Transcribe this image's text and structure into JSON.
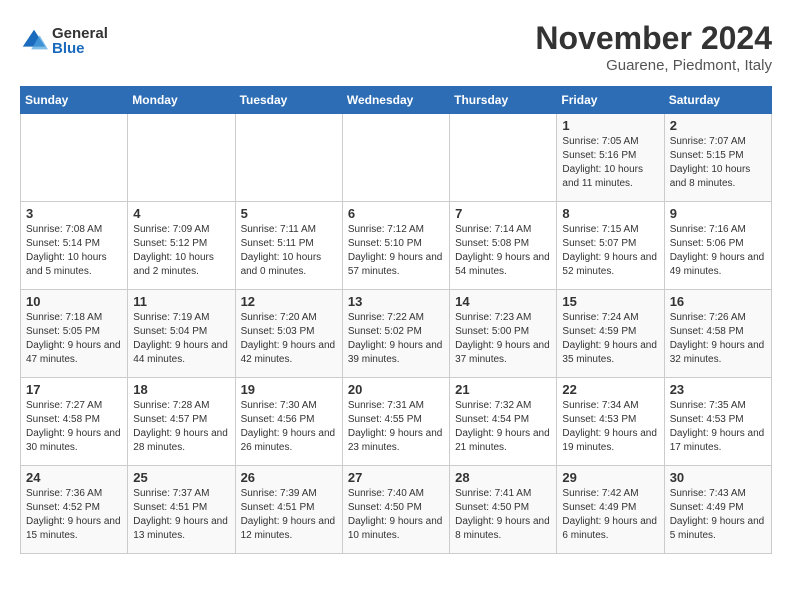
{
  "logo": {
    "general": "General",
    "blue": "Blue"
  },
  "title": "November 2024",
  "subtitle": "Guarene, Piedmont, Italy",
  "weekdays": [
    "Sunday",
    "Monday",
    "Tuesday",
    "Wednesday",
    "Thursday",
    "Friday",
    "Saturday"
  ],
  "weeks": [
    [
      {
        "day": "",
        "info": ""
      },
      {
        "day": "",
        "info": ""
      },
      {
        "day": "",
        "info": ""
      },
      {
        "day": "",
        "info": ""
      },
      {
        "day": "",
        "info": ""
      },
      {
        "day": "1",
        "info": "Sunrise: 7:05 AM\nSunset: 5:16 PM\nDaylight: 10 hours and 11 minutes."
      },
      {
        "day": "2",
        "info": "Sunrise: 7:07 AM\nSunset: 5:15 PM\nDaylight: 10 hours and 8 minutes."
      }
    ],
    [
      {
        "day": "3",
        "info": "Sunrise: 7:08 AM\nSunset: 5:14 PM\nDaylight: 10 hours and 5 minutes."
      },
      {
        "day": "4",
        "info": "Sunrise: 7:09 AM\nSunset: 5:12 PM\nDaylight: 10 hours and 2 minutes."
      },
      {
        "day": "5",
        "info": "Sunrise: 7:11 AM\nSunset: 5:11 PM\nDaylight: 10 hours and 0 minutes."
      },
      {
        "day": "6",
        "info": "Sunrise: 7:12 AM\nSunset: 5:10 PM\nDaylight: 9 hours and 57 minutes."
      },
      {
        "day": "7",
        "info": "Sunrise: 7:14 AM\nSunset: 5:08 PM\nDaylight: 9 hours and 54 minutes."
      },
      {
        "day": "8",
        "info": "Sunrise: 7:15 AM\nSunset: 5:07 PM\nDaylight: 9 hours and 52 minutes."
      },
      {
        "day": "9",
        "info": "Sunrise: 7:16 AM\nSunset: 5:06 PM\nDaylight: 9 hours and 49 minutes."
      }
    ],
    [
      {
        "day": "10",
        "info": "Sunrise: 7:18 AM\nSunset: 5:05 PM\nDaylight: 9 hours and 47 minutes."
      },
      {
        "day": "11",
        "info": "Sunrise: 7:19 AM\nSunset: 5:04 PM\nDaylight: 9 hours and 44 minutes."
      },
      {
        "day": "12",
        "info": "Sunrise: 7:20 AM\nSunset: 5:03 PM\nDaylight: 9 hours and 42 minutes."
      },
      {
        "day": "13",
        "info": "Sunrise: 7:22 AM\nSunset: 5:02 PM\nDaylight: 9 hours and 39 minutes."
      },
      {
        "day": "14",
        "info": "Sunrise: 7:23 AM\nSunset: 5:00 PM\nDaylight: 9 hours and 37 minutes."
      },
      {
        "day": "15",
        "info": "Sunrise: 7:24 AM\nSunset: 4:59 PM\nDaylight: 9 hours and 35 minutes."
      },
      {
        "day": "16",
        "info": "Sunrise: 7:26 AM\nSunset: 4:58 PM\nDaylight: 9 hours and 32 minutes."
      }
    ],
    [
      {
        "day": "17",
        "info": "Sunrise: 7:27 AM\nSunset: 4:58 PM\nDaylight: 9 hours and 30 minutes."
      },
      {
        "day": "18",
        "info": "Sunrise: 7:28 AM\nSunset: 4:57 PM\nDaylight: 9 hours and 28 minutes."
      },
      {
        "day": "19",
        "info": "Sunrise: 7:30 AM\nSunset: 4:56 PM\nDaylight: 9 hours and 26 minutes."
      },
      {
        "day": "20",
        "info": "Sunrise: 7:31 AM\nSunset: 4:55 PM\nDaylight: 9 hours and 23 minutes."
      },
      {
        "day": "21",
        "info": "Sunrise: 7:32 AM\nSunset: 4:54 PM\nDaylight: 9 hours and 21 minutes."
      },
      {
        "day": "22",
        "info": "Sunrise: 7:34 AM\nSunset: 4:53 PM\nDaylight: 9 hours and 19 minutes."
      },
      {
        "day": "23",
        "info": "Sunrise: 7:35 AM\nSunset: 4:53 PM\nDaylight: 9 hours and 17 minutes."
      }
    ],
    [
      {
        "day": "24",
        "info": "Sunrise: 7:36 AM\nSunset: 4:52 PM\nDaylight: 9 hours and 15 minutes."
      },
      {
        "day": "25",
        "info": "Sunrise: 7:37 AM\nSunset: 4:51 PM\nDaylight: 9 hours and 13 minutes."
      },
      {
        "day": "26",
        "info": "Sunrise: 7:39 AM\nSunset: 4:51 PM\nDaylight: 9 hours and 12 minutes."
      },
      {
        "day": "27",
        "info": "Sunrise: 7:40 AM\nSunset: 4:50 PM\nDaylight: 9 hours and 10 minutes."
      },
      {
        "day": "28",
        "info": "Sunrise: 7:41 AM\nSunset: 4:50 PM\nDaylight: 9 hours and 8 minutes."
      },
      {
        "day": "29",
        "info": "Sunrise: 7:42 AM\nSunset: 4:49 PM\nDaylight: 9 hours and 6 minutes."
      },
      {
        "day": "30",
        "info": "Sunrise: 7:43 AM\nSunset: 4:49 PM\nDaylight: 9 hours and 5 minutes."
      }
    ]
  ]
}
